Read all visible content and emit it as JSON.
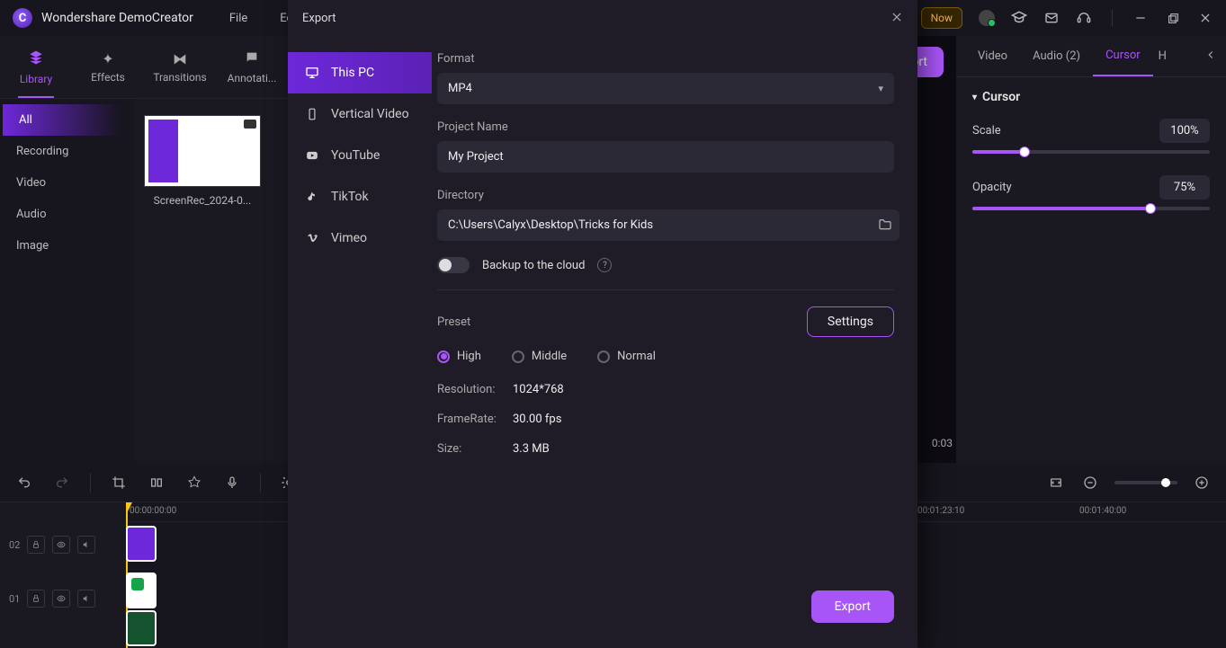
{
  "app": {
    "title": "Wondershare DemoCreator"
  },
  "menu": {
    "file": "File",
    "edit": "Edit"
  },
  "titlebar": {
    "now_badge": "Now"
  },
  "tool_tabs": {
    "library": "Library",
    "effects": "Effects",
    "transitions": "Transitions",
    "annotations": "Annotati..."
  },
  "library": {
    "categories": {
      "all": "All",
      "recording": "Recording",
      "video": "Video",
      "audio": "Audio",
      "image": "Image"
    },
    "item_label": "ScreenRec_2024-0..."
  },
  "export_button": "Export",
  "right_panel": {
    "tabs": {
      "video": "Video",
      "audio": "Audio (2)",
      "cursor": "Cursor",
      "highlight": "H"
    },
    "group_title": "Cursor",
    "scale_label": "Scale",
    "scale_value": "100%",
    "opacity_label": "Opacity",
    "opacity_value": "75%"
  },
  "timeline": {
    "start_time": "00:00:00:00",
    "t1": "00:01:23:10",
    "t2": "00:01:40:00",
    "track_02": "02",
    "track_01": "01"
  },
  "preview": {
    "dur_right": "0:03"
  },
  "modal": {
    "title": "Export",
    "nav": {
      "this_pc": "This PC",
      "vertical": "Vertical Video",
      "youtube": "YouTube",
      "tiktok": "TikTok",
      "vimeo": "Vimeo"
    },
    "format_label": "Format",
    "format_value": "MP4",
    "project_label": "Project Name",
    "project_value": "My Project",
    "directory_label": "Directory",
    "directory_value": "C:\\Users\\Calyx\\Desktop\\Tricks for Kids",
    "backup_label": "Backup to the cloud",
    "preset_label": "Preset",
    "settings_btn": "Settings",
    "preset_high": "High",
    "preset_middle": "Middle",
    "preset_normal": "Normal",
    "resolution_k": "Resolution:",
    "resolution_v": "1024*768",
    "framerate_k": "FrameRate:",
    "framerate_v": "30.00 fps",
    "size_k": "Size:",
    "size_v": "3.3 MB",
    "export_btn": "Export"
  }
}
